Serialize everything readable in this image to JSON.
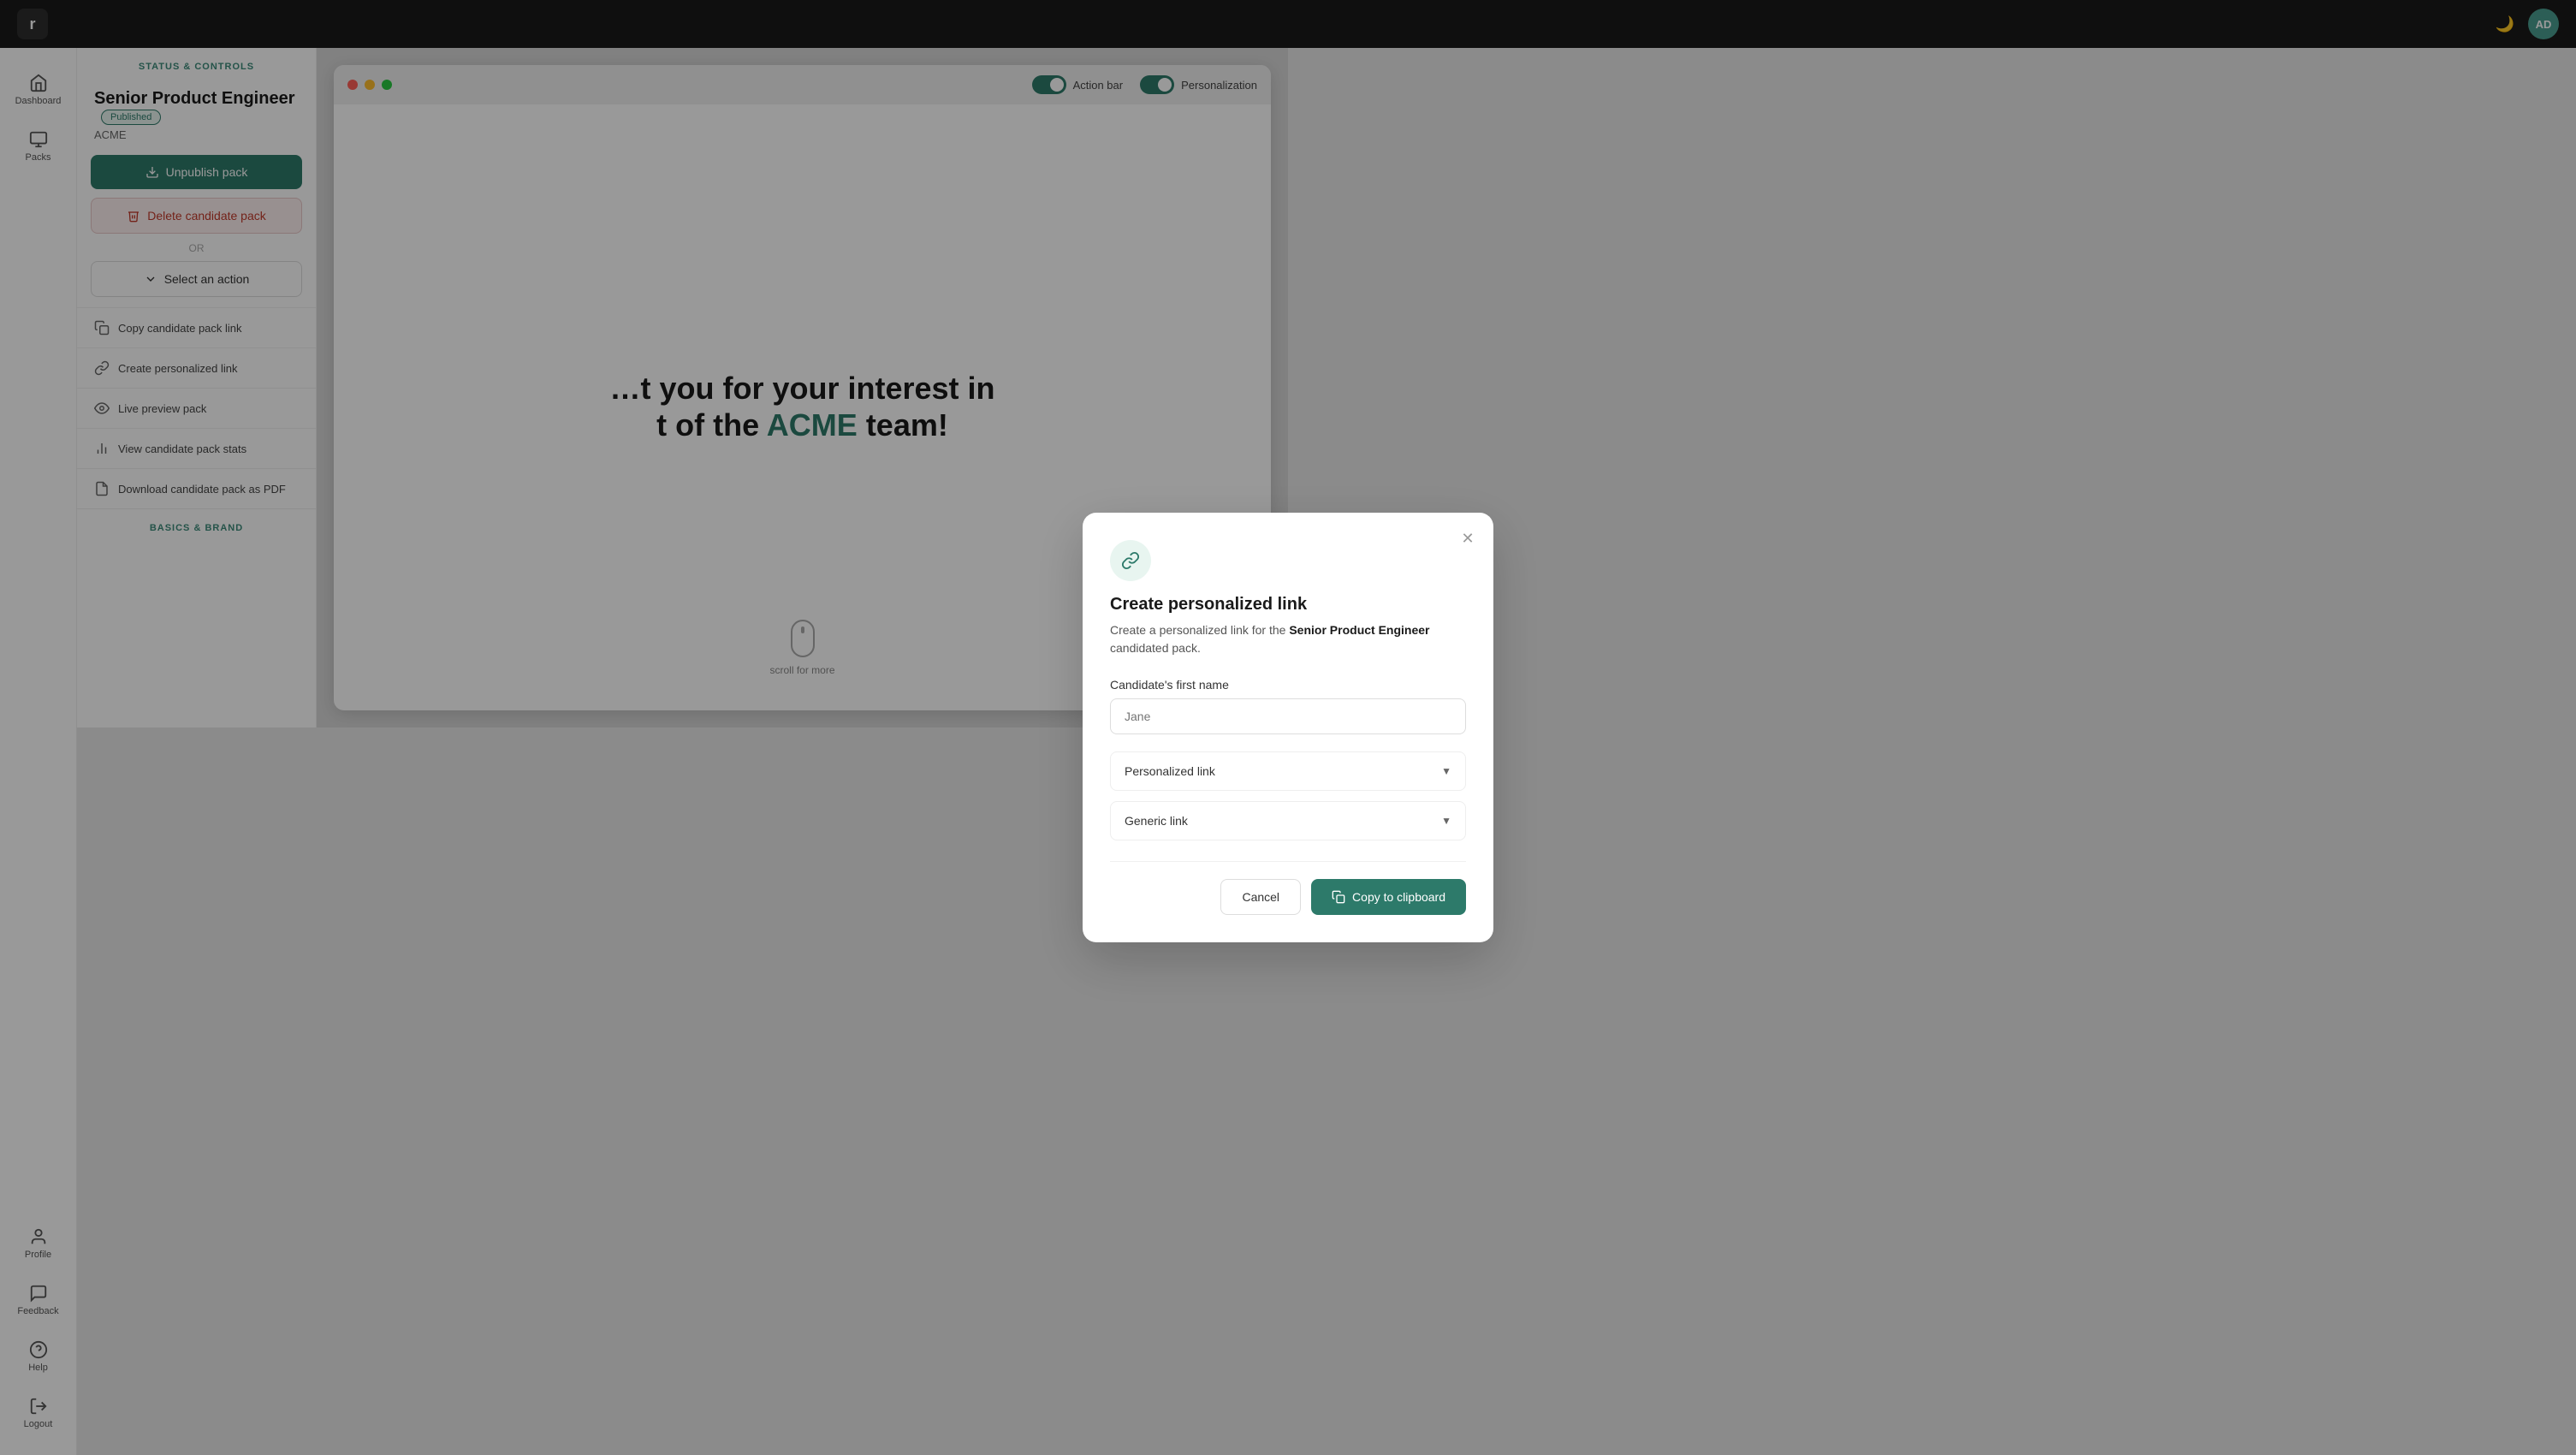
{
  "topbar": {
    "logo_text": "r",
    "avatar_text": "AD"
  },
  "sidebar": {
    "items": [
      {
        "id": "dashboard",
        "label": "Dashboard",
        "icon": "home"
      },
      {
        "id": "packs",
        "label": "Packs",
        "icon": "box"
      },
      {
        "id": "profile",
        "label": "Profile",
        "icon": "user"
      },
      {
        "id": "feedback",
        "label": "Feedback",
        "icon": "message"
      },
      {
        "id": "help",
        "label": "Help",
        "icon": "help-circle"
      },
      {
        "id": "logout",
        "label": "Logout",
        "icon": "log-out"
      }
    ]
  },
  "left_panel": {
    "section_header": "STATUS & CONTROLS",
    "job_title": "Senior Product Engineer",
    "job_badge": "Published",
    "job_company": "ACME",
    "btn_unpublish": "Unpublish pack",
    "btn_delete": "Delete candidate pack",
    "or_text": "OR",
    "btn_select_action": "Select an action",
    "actions": [
      {
        "id": "copy-link",
        "label": "Copy candidate pack link",
        "icon": "link"
      },
      {
        "id": "create-personalized",
        "label": "Create personalized link",
        "icon": "chain"
      },
      {
        "id": "live-preview",
        "label": "Live preview pack",
        "icon": "eye"
      },
      {
        "id": "view-stats",
        "label": "View candidate pack stats",
        "icon": "bar-chart"
      },
      {
        "id": "download-pdf",
        "label": "Download candidate pack as PDF",
        "icon": "file"
      }
    ],
    "basics_header": "BASICS & BRAND"
  },
  "right_panel": {
    "window_dots": [
      "red",
      "yellow",
      "green"
    ],
    "toggle_action_bar": "Action bar",
    "toggle_personalization": "Personalization",
    "preview_heading_part1": "t you for your interest in",
    "preview_heading_part2": "t of the",
    "preview_brand": "ACME",
    "preview_heading_part3": "team!",
    "scroll_text": "scroll for more"
  },
  "modal": {
    "title": "Create personalized link",
    "description_prefix": "Create a personalized link for the",
    "description_bold": "Senior Product Engineer",
    "description_suffix": "candidated pack.",
    "label_first_name": "Candidate's first name",
    "input_placeholder": "Jane",
    "section_personalized": "Personalized link",
    "section_generic": "Generic link",
    "btn_cancel": "Cancel",
    "btn_copy": "Copy to clipboard"
  }
}
